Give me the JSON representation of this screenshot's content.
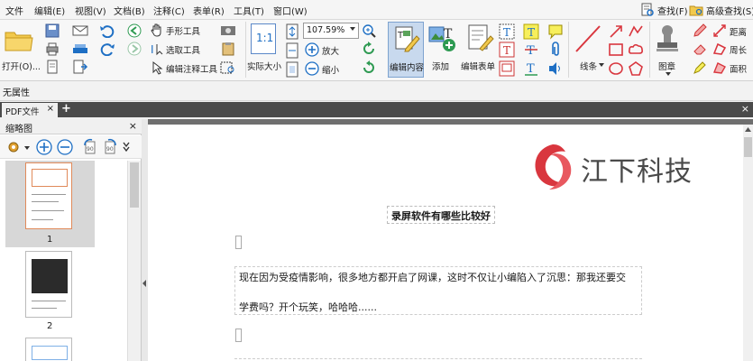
{
  "menu": {
    "items": [
      "文件",
      "编辑(E)",
      "视图(V)",
      "文档(B)",
      "注释(C)",
      "表单(R)",
      "工具(T)",
      "窗口(W)"
    ],
    "find": "查找(F)",
    "advanced_find": "高级查找(S)"
  },
  "ribbon": {
    "open": "打开(O)...",
    "hand_tool": "手形工具",
    "select_tool": "选取工具",
    "edit_annot_tool": "编辑注释工具",
    "actual_size": "实际大小",
    "zoom_value": "107.59%",
    "zoom_in": "放大",
    "zoom_out": "缩小",
    "edit_content": "编辑内容",
    "add": "添加",
    "edit_form": "编辑表单",
    "lines": "线条",
    "stamp": "图章",
    "distance": "距离",
    "perimeter": "周长",
    "area": "面积"
  },
  "properties": {
    "label": "无属性"
  },
  "tabs": {
    "doc_tab": "PDF文件"
  },
  "thumbnail_panel": {
    "title": "缩略图",
    "pages": [
      "1",
      "2"
    ]
  },
  "document": {
    "logo_text": "江下科技",
    "title": "录屏软件有哪些比较好",
    "para_line1": "现在因为受疫情影响，很多地方都开启了网课，这时不仅让小编陷入了沉思：那我还要交",
    "para_line2": "学费吗？开个玩笑，哈哈哈......"
  },
  "colors": {
    "accent_blue": "#1e6fc4",
    "logo_red": "#d9363e",
    "highlight": "#c8d9ee"
  }
}
